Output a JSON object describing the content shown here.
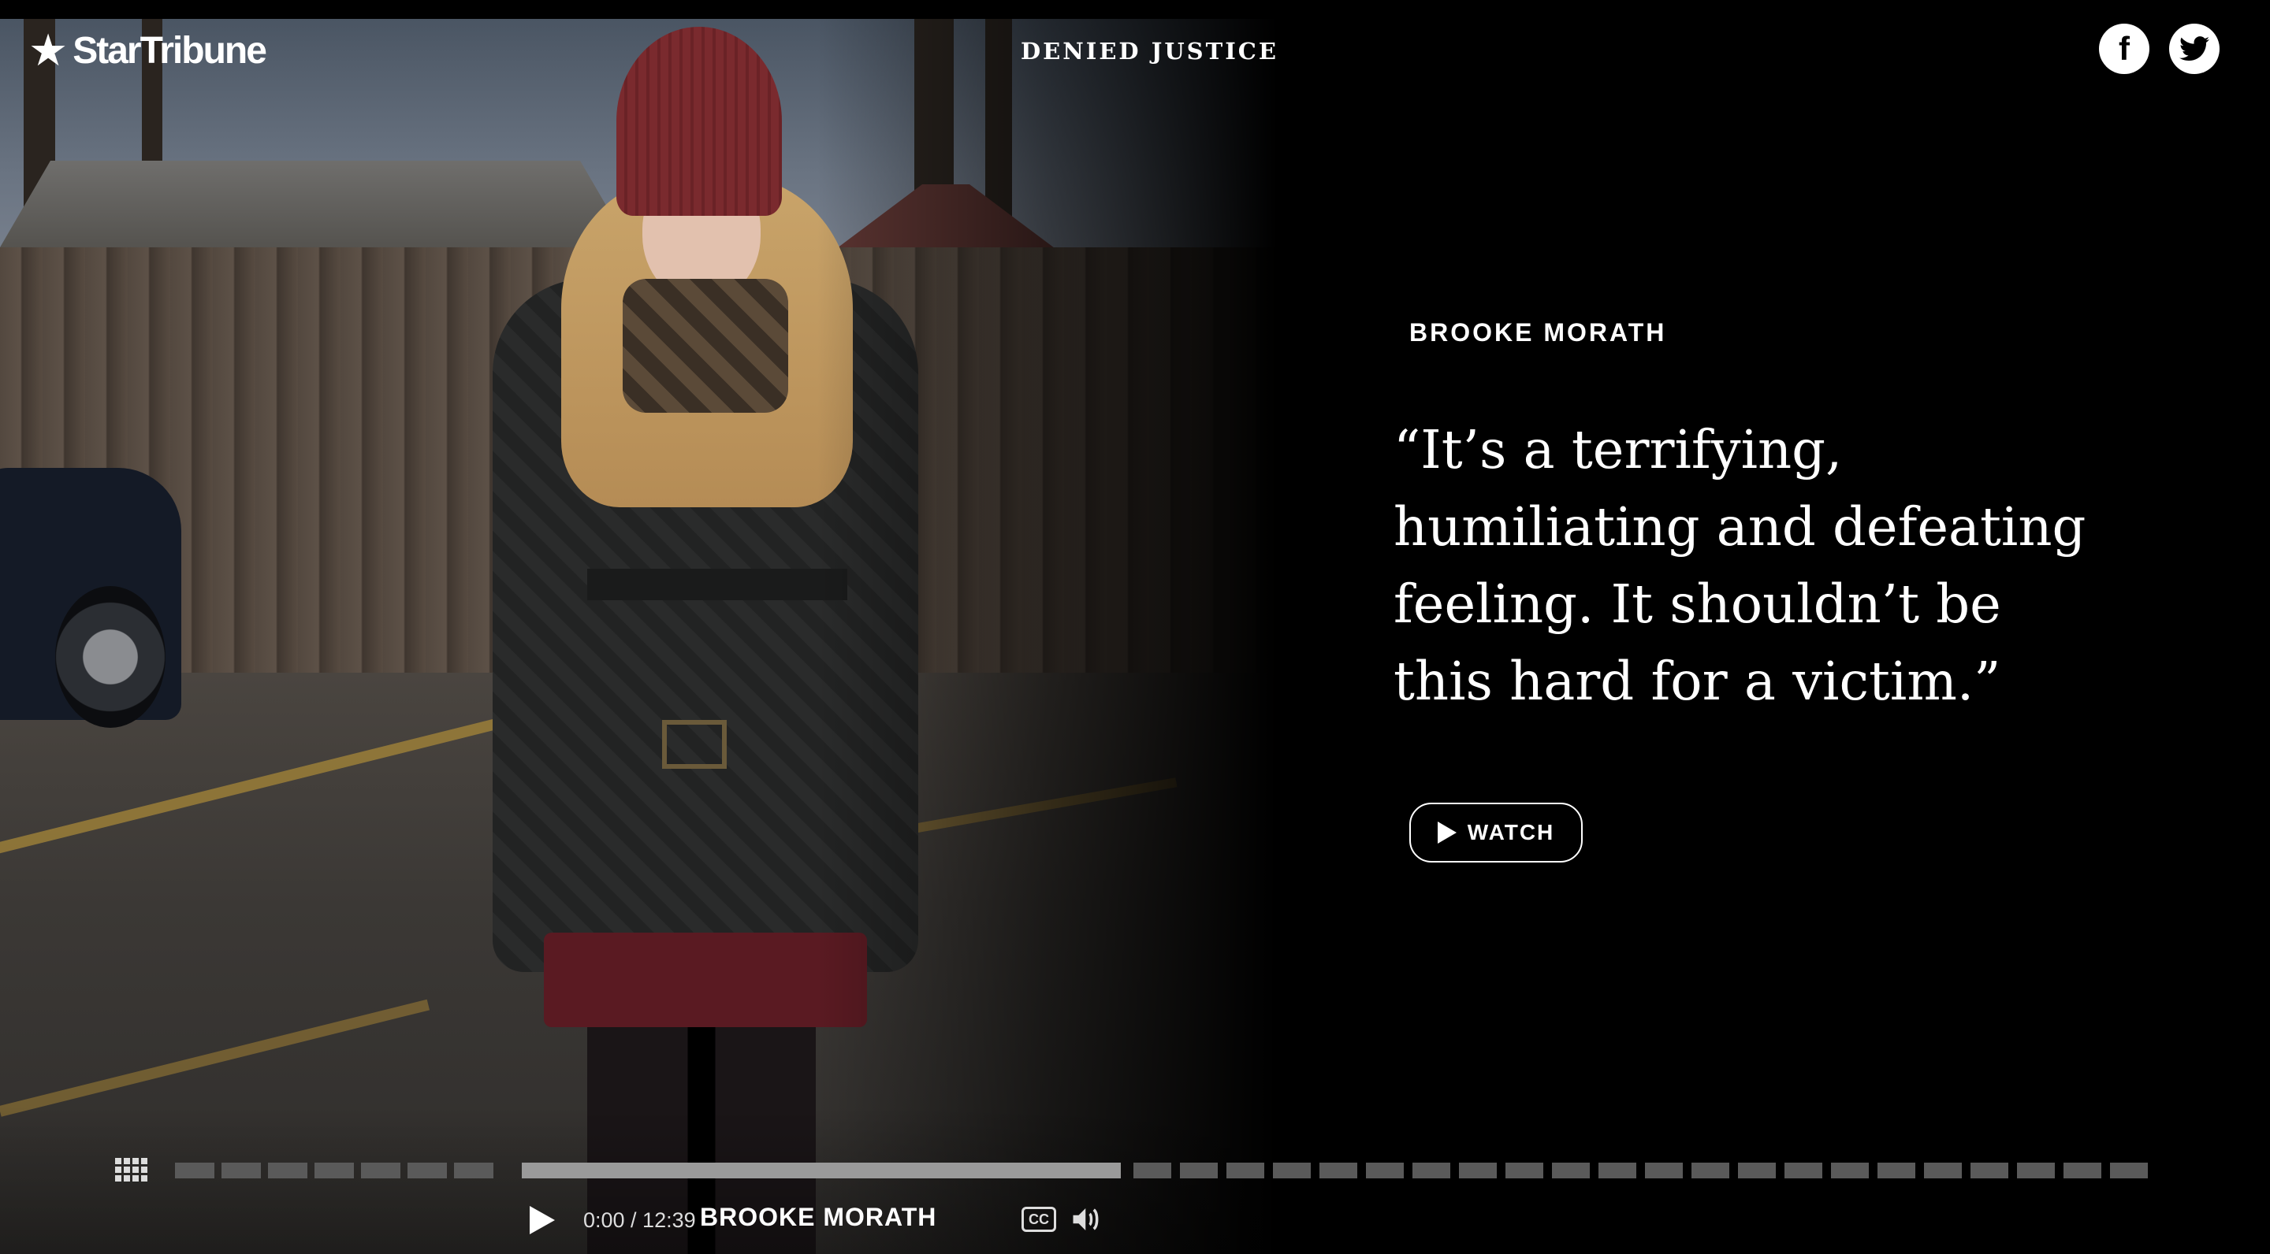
{
  "header": {
    "logo_text": "StarTribune",
    "section_title": "DENIED JUSTICE",
    "social": {
      "facebook_icon": "facebook-icon",
      "facebook_glyph": "f",
      "twitter_icon": "twitter-icon"
    }
  },
  "feature": {
    "speaker_name": "BROOKE MORATH",
    "quote": "“It’s a terrifying, humiliating and defeating feeling. It shouldn’t be this hard for a victim.”",
    "watch_label": "WATCH",
    "watch_icon": "play-icon"
  },
  "player": {
    "chapters_icon": "grid-icon",
    "timeline_highlighted_segment": 8,
    "play_icon": "play-icon",
    "time": "0:00 / 12:39",
    "current_title": "BROOKE MORATH",
    "cc_label": "CC",
    "volume_icon": "volume-icon"
  },
  "colors": {
    "background": "#000000",
    "text": "#ffffff",
    "timeline_segment": "#5a5a5a",
    "timeline_highlight": "#9a9a9a"
  }
}
